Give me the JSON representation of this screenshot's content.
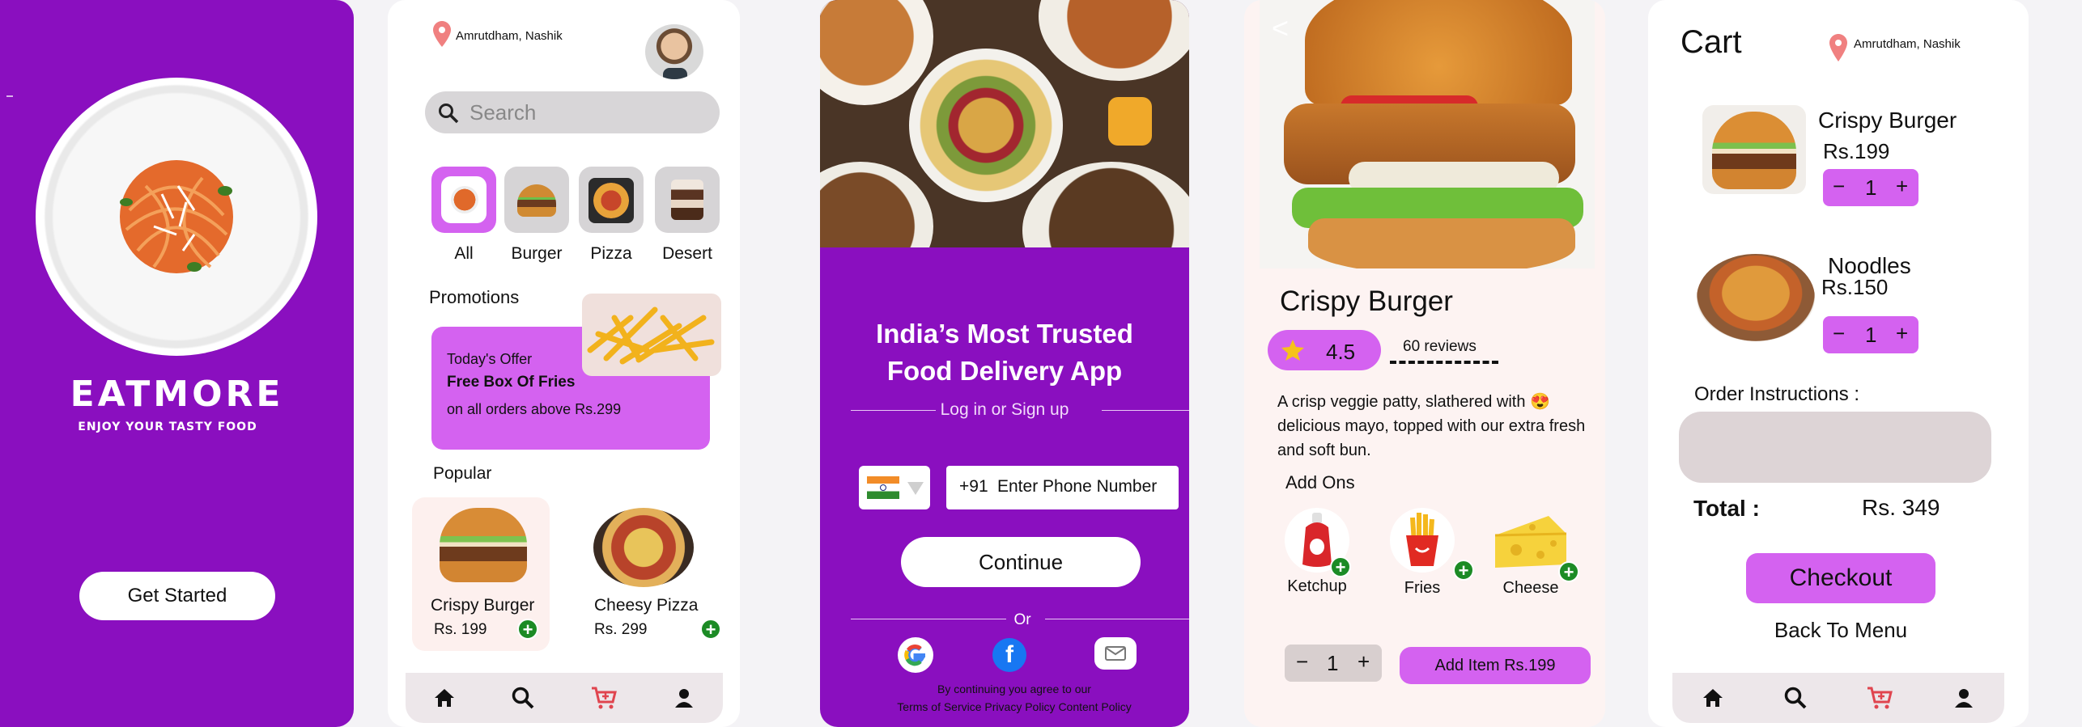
{
  "screen1": {
    "brand": "EATMORE",
    "tagline": "ENJOY YOUR TASTY FOOD",
    "get_started": "Get Started"
  },
  "screen2": {
    "location": "Amrutdham, Nashik",
    "search_placeholder": "Search",
    "categories": [
      "All",
      "Burger",
      "Pizza",
      "Desert"
    ],
    "promotions_title": "Promotions",
    "promo": {
      "line1": "Today's Offer",
      "line2": "Free Box Of Fries",
      "line3": "on all orders above Rs.299"
    },
    "popular_title": "Popular",
    "popular": [
      {
        "name": "Crispy Burger",
        "price": "Rs. 199"
      },
      {
        "name": "Cheesy Pizza",
        "price": "Rs. 299"
      }
    ]
  },
  "screen3": {
    "headline1": "India’s Most Trusted",
    "headline2": "Food Delivery App",
    "login_label": "Log in or Sign up",
    "phone_prefix": "+91",
    "phone_placeholder": "Enter Phone Number",
    "continue": "Continue",
    "or": "Or",
    "footer1": "By continuing you agree to our",
    "footer2": "Terms of Service Privacy Policy Content Policy"
  },
  "screen4": {
    "back": "<",
    "title": "Crispy Burger",
    "rating": "4.5",
    "reviews": "60 reviews",
    "description": "A crisp veggie patty, slathered with 😍 delicious mayo, topped with our extra fresh and soft bun.",
    "addons_title": "Add Ons",
    "addons": [
      "Ketchup",
      "Fries",
      "Cheese"
    ],
    "qty": "1",
    "minus": "−",
    "plus": "+",
    "add_button": "Add Item Rs.199"
  },
  "screen5": {
    "title": "Cart",
    "location": "Amrutdham, Nashik",
    "items": [
      {
        "name": "Crispy Burger",
        "price": "Rs.199",
        "qty": "1"
      },
      {
        "name": "Noodles",
        "price": "Rs.150",
        "qty": "1"
      }
    ],
    "instructions_label": "Order Instructions :",
    "total_label": "Total :",
    "total_value": "Rs. 349",
    "checkout": "Checkout",
    "back_to_menu": "Back To Menu"
  },
  "colors": {
    "primary": "#8a0fbf",
    "accent": "#d462f0",
    "green": "#1c8b25"
  }
}
